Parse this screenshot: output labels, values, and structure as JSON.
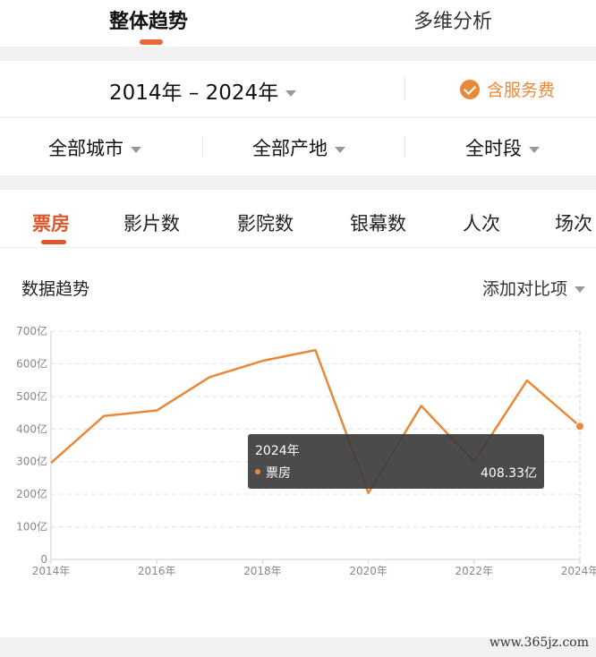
{
  "top_tabs": {
    "overall": "整体趋势",
    "multi": "多维分析"
  },
  "year_range": "2014年 – 2024年",
  "service_fee_label": "含服务费",
  "filters": {
    "city": "全部城市",
    "origin": "全部产地",
    "period": "全时段"
  },
  "metric_tabs": [
    "票房",
    "影片数",
    "影院数",
    "银幕数",
    "人次",
    "场次"
  ],
  "section_title": "数据趋势",
  "compare_label": "添加对比项",
  "tooltip": {
    "title": "2024年",
    "series": "票房",
    "value": "408.33亿"
  },
  "watermark": "www.365jz.com",
  "colors": {
    "accent": "#e0562a",
    "line": "#e8893a"
  },
  "chart_data": {
    "type": "line",
    "x": [
      2014,
      2015,
      2016,
      2017,
      2018,
      2019,
      2020,
      2021,
      2022,
      2023,
      2024
    ],
    "x_tick_labels": [
      "2014年",
      "2016年",
      "2018年",
      "2020年",
      "2022年",
      "2024年"
    ],
    "x_tick_values": [
      2014,
      2016,
      2018,
      2020,
      2022,
      2024
    ],
    "y_tick_labels": [
      "0",
      "100亿",
      "200亿",
      "300亿",
      "400亿",
      "500亿",
      "600亿",
      "700亿"
    ],
    "y_tick_values": [
      0,
      100,
      200,
      300,
      400,
      500,
      600,
      700
    ],
    "ylim": [
      0,
      700
    ],
    "xlim": [
      2014,
      2024
    ],
    "series": [
      {
        "name": "票房",
        "values": [
          296,
          440,
          457,
          559,
          609,
          642,
          204,
          471,
          300,
          549,
          408.33
        ]
      }
    ],
    "grid": true
  }
}
